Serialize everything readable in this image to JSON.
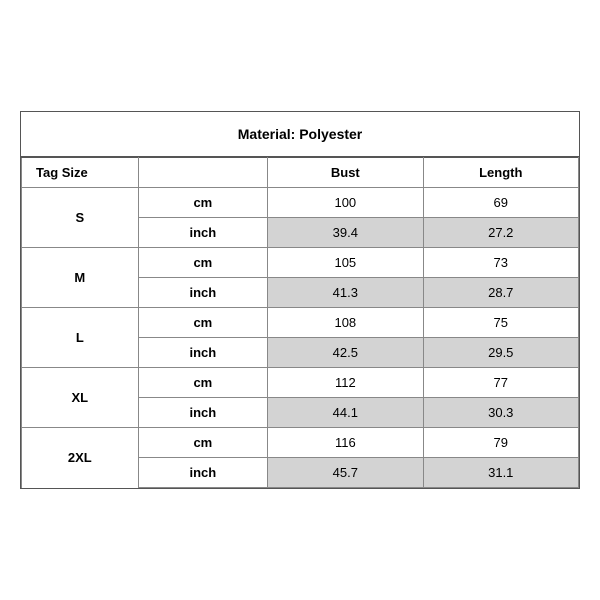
{
  "title": "Material: Polyester",
  "headers": {
    "tag_size": "Tag Size",
    "bust": "Bust",
    "length": "Length"
  },
  "sizes": [
    {
      "label": "S",
      "cm": {
        "unit": "cm",
        "bust": "100",
        "length": "69"
      },
      "inch": {
        "unit": "inch",
        "bust": "39.4",
        "length": "27.2"
      }
    },
    {
      "label": "M",
      "cm": {
        "unit": "cm",
        "bust": "105",
        "length": "73"
      },
      "inch": {
        "unit": "inch",
        "bust": "41.3",
        "length": "28.7"
      }
    },
    {
      "label": "L",
      "cm": {
        "unit": "cm",
        "bust": "108",
        "length": "75"
      },
      "inch": {
        "unit": "inch",
        "bust": "42.5",
        "length": "29.5"
      }
    },
    {
      "label": "XL",
      "cm": {
        "unit": "cm",
        "bust": "112",
        "length": "77"
      },
      "inch": {
        "unit": "inch",
        "bust": "44.1",
        "length": "30.3"
      }
    },
    {
      "label": "2XL",
      "cm": {
        "unit": "cm",
        "bust": "116",
        "length": "79"
      },
      "inch": {
        "unit": "inch",
        "bust": "45.7",
        "length": "31.1"
      }
    }
  ]
}
